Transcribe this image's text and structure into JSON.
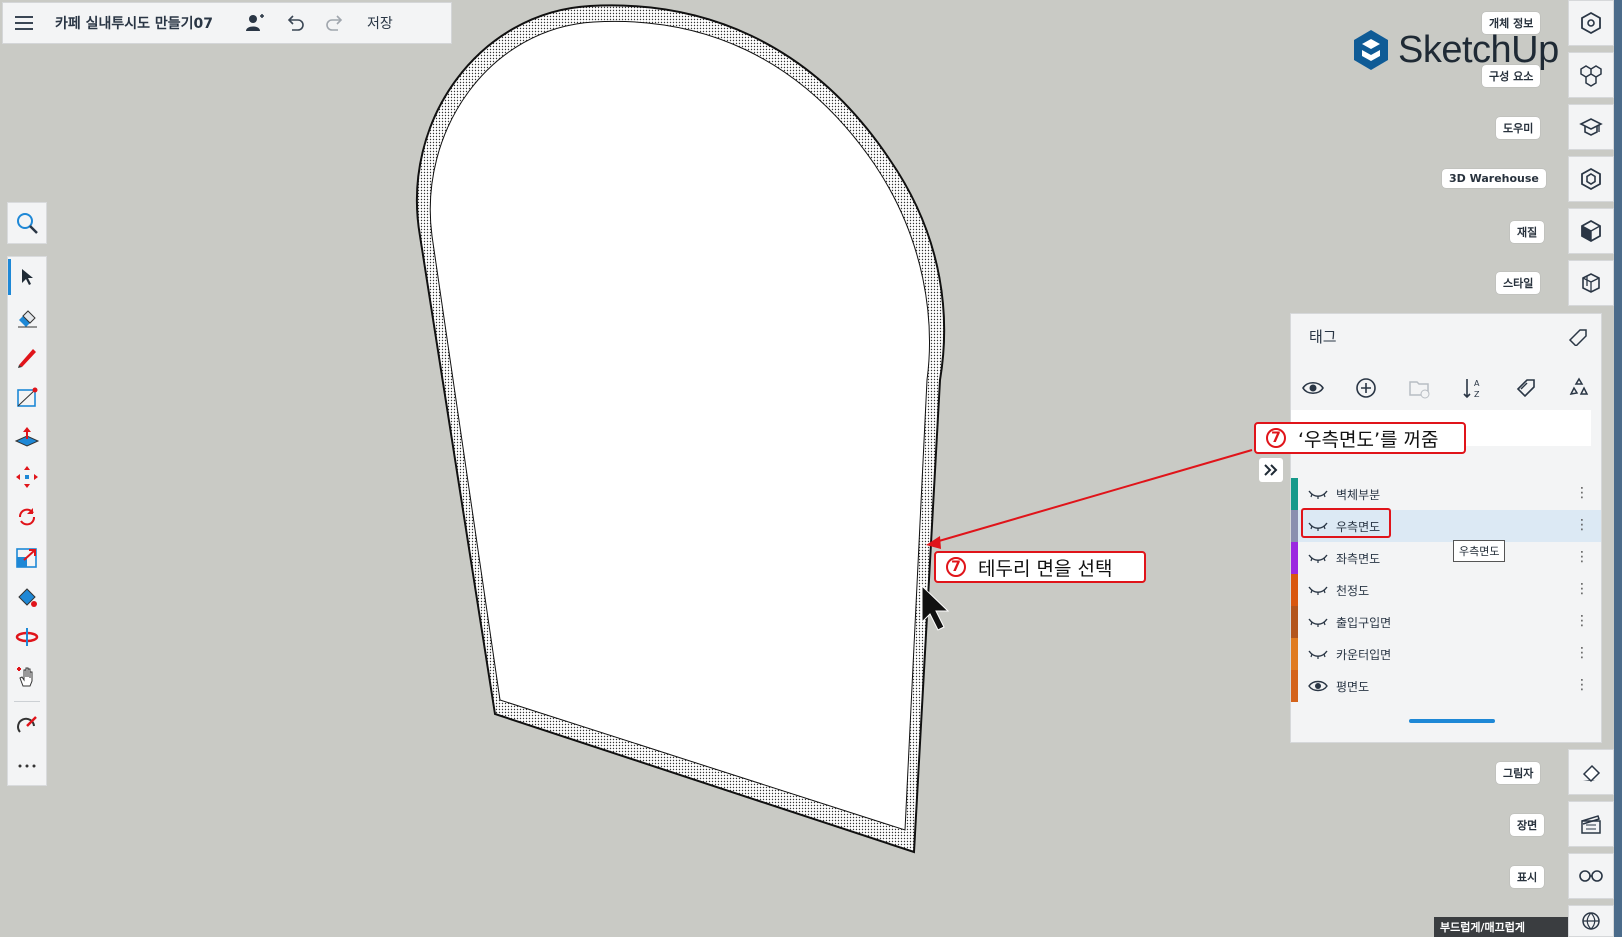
{
  "topbar": {
    "title": "카페 실내투시도 만들기07",
    "save_label": "저장"
  },
  "logo": {
    "text": "SketchUp"
  },
  "right_tray": {
    "entity_info": "개체 정보",
    "components": "구성 요소",
    "instructor": "도우미",
    "warehouse": "3D Warehouse",
    "materials": "재질",
    "styles": "스타일",
    "shadows": "그림자",
    "scenes": "장면",
    "display": "표시",
    "soften": "부드럽게/매끄럽게"
  },
  "tags_panel": {
    "title": "태그",
    "tooltip": "우측면도",
    "tags": [
      {
        "name": "벽체부분",
        "visible": false,
        "color": "#16998a"
      },
      {
        "name": "우측면도",
        "visible": false,
        "color": "#8a8faf"
      },
      {
        "name": "좌측면도",
        "visible": false,
        "color": "#9b27e0"
      },
      {
        "name": "천정도",
        "visible": false,
        "color": "#d9570f"
      },
      {
        "name": "출입구입면",
        "visible": false,
        "color": "#b3551d"
      },
      {
        "name": "카운터입면",
        "visible": false,
        "color": "#e07b20"
      },
      {
        "name": "평면도",
        "visible": true,
        "color": "#d4631c"
      }
    ]
  },
  "annotations": {
    "step1_num": "7",
    "step1_text": "‘우측면도’를 꺼줌",
    "step2_num": "7",
    "step2_text": "테두리 면을 선택"
  },
  "colors": {
    "accent": "#1e88d6",
    "callout": "#e0141a",
    "canvas": "#c9cac5"
  }
}
